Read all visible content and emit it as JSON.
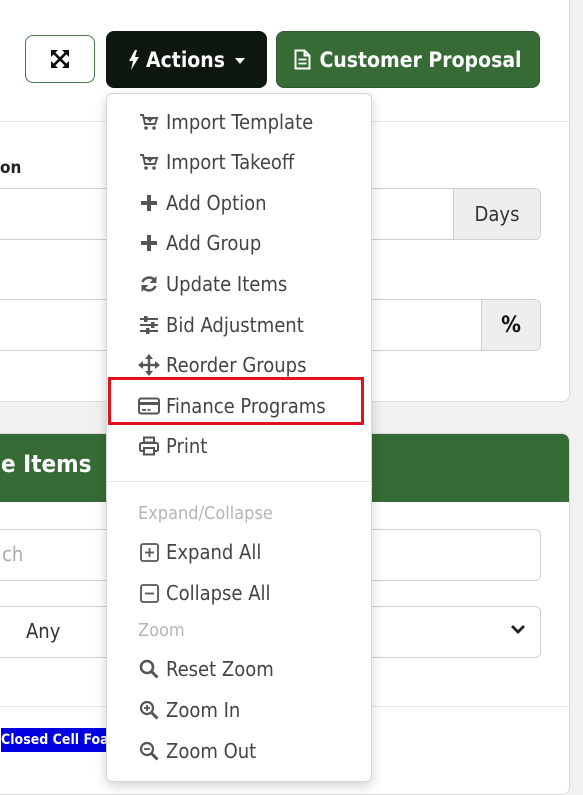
{
  "toolbar": {
    "actions_label": "Actions",
    "proposal_label": "Customer Proposal"
  },
  "form": {
    "partial_label": "on",
    "days_addon": "Days",
    "percent_addon": "%"
  },
  "items_panel": {
    "title": "e Items",
    "search_placeholder": "ch",
    "filter_value": "Any",
    "tag_label": "Closed Cell Foa"
  },
  "menu": {
    "import_template": "Import Template",
    "import_takeoff": "Import Takeoff",
    "add_option": "Add Option",
    "add_group": "Add Group",
    "update_items": "Update Items",
    "bid_adjustment": "Bid Adjustment",
    "reorder_groups": "Reorder Groups",
    "finance_programs": "Finance Programs",
    "print": "Print",
    "header_expand_collapse": "Expand/Collapse",
    "expand_all": "Expand All",
    "collapse_all": "Collapse All",
    "header_zoom": "Zoom",
    "reset_zoom": "Reset Zoom",
    "zoom_in": "Zoom In",
    "zoom_out": "Zoom Out"
  },
  "colors": {
    "brand_green": "#376b36",
    "dark_button": "#0e170e",
    "highlight_red": "#e0121e",
    "tag_blue": "#0000e0"
  }
}
